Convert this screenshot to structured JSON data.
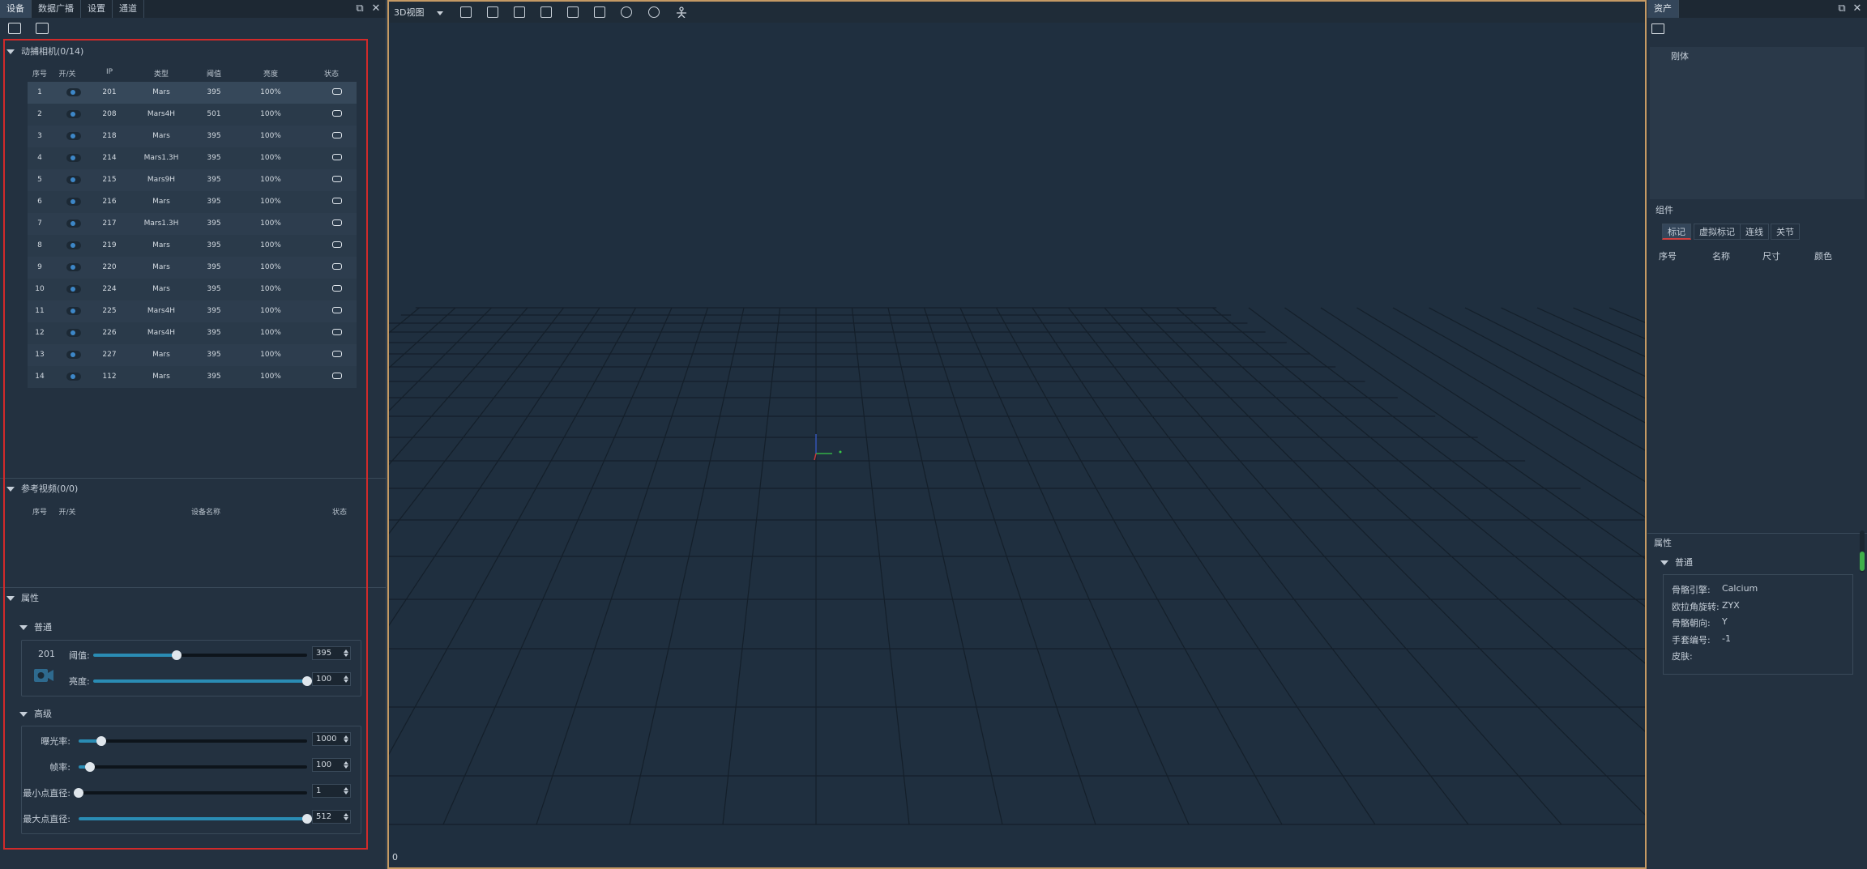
{
  "left": {
    "tabs": [
      "设备",
      "数据广播",
      "设置",
      "通道"
    ],
    "mocap": {
      "title": "动捕相机(0/14)",
      "headers": [
        "序号",
        "开/关",
        "IP",
        "类型",
        "阈值",
        "亮度",
        "状态"
      ],
      "rows": [
        {
          "no": "1",
          "ip": "201",
          "type": "Mars",
          "threshold": "395",
          "brightness": "100%"
        },
        {
          "no": "2",
          "ip": "208",
          "type": "Mars4H",
          "threshold": "501",
          "brightness": "100%"
        },
        {
          "no": "3",
          "ip": "218",
          "type": "Mars",
          "threshold": "395",
          "brightness": "100%"
        },
        {
          "no": "4",
          "ip": "214",
          "type": "Mars1.3H",
          "threshold": "395",
          "brightness": "100%"
        },
        {
          "no": "5",
          "ip": "215",
          "type": "Mars9H",
          "threshold": "395",
          "brightness": "100%"
        },
        {
          "no": "6",
          "ip": "216",
          "type": "Mars",
          "threshold": "395",
          "brightness": "100%"
        },
        {
          "no": "7",
          "ip": "217",
          "type": "Mars1.3H",
          "threshold": "395",
          "brightness": "100%"
        },
        {
          "no": "8",
          "ip": "219",
          "type": "Mars",
          "threshold": "395",
          "brightness": "100%"
        },
        {
          "no": "9",
          "ip": "220",
          "type": "Mars",
          "threshold": "395",
          "brightness": "100%"
        },
        {
          "no": "10",
          "ip": "224",
          "type": "Mars",
          "threshold": "395",
          "brightness": "100%"
        },
        {
          "no": "11",
          "ip": "225",
          "type": "Mars4H",
          "threshold": "395",
          "brightness": "100%"
        },
        {
          "no": "12",
          "ip": "226",
          "type": "Mars4H",
          "threshold": "395",
          "brightness": "100%"
        },
        {
          "no": "13",
          "ip": "227",
          "type": "Mars",
          "threshold": "395",
          "brightness": "100%"
        },
        {
          "no": "14",
          "ip": "112",
          "type": "Mars",
          "threshold": "395",
          "brightness": "100%"
        }
      ]
    },
    "ref_video": {
      "title": "参考视频(0/0)",
      "headers": [
        "序号",
        "开/关",
        "设备名称",
        "状态"
      ]
    },
    "props": {
      "title": "属性",
      "general": {
        "title": "普通",
        "camera_id": "201",
        "threshold_label": "阈值:",
        "threshold_value": "395",
        "threshold_fraction": 0.39,
        "brightness_label": "亮度:",
        "brightness_value": "100",
        "brightness_fraction": 1.0
      },
      "advanced": {
        "title": "高级",
        "items": [
          {
            "label": "曝光率:",
            "value": "1000",
            "fraction": 0.1
          },
          {
            "label": "帧率:",
            "value": "100",
            "fraction": 0.05
          },
          {
            "label": "最小点直径:",
            "value": "1",
            "fraction": 0.0
          },
          {
            "label": "最大点直径:",
            "value": "512",
            "fraction": 1.0
          }
        ]
      }
    }
  },
  "center": {
    "view_label": "3D视图",
    "frame_number": "0"
  },
  "right": {
    "tab": "资产",
    "rigid_label": "刚体",
    "components_label": "组件",
    "tabs": [
      "标记",
      "虚拟标记",
      "连线",
      "关节"
    ],
    "columns": [
      "序号",
      "名称",
      "尺寸",
      "颜色"
    ],
    "props_label": "属性",
    "general_label": "普通",
    "kv": [
      {
        "k": "骨骼引擎:",
        "v": "Calcium"
      },
      {
        "k": "欧拉角旋转:",
        "v": "ZYX"
      },
      {
        "k": "骨骼朝向:",
        "v": "Y"
      },
      {
        "k": "手套编号:",
        "v": "-1"
      },
      {
        "k": "皮肤:",
        "v": ""
      }
    ]
  },
  "colors": {
    "accent": "#2a8cb4",
    "highlight_border": "#d22a2a",
    "viewport_border": "#c59a64"
  }
}
